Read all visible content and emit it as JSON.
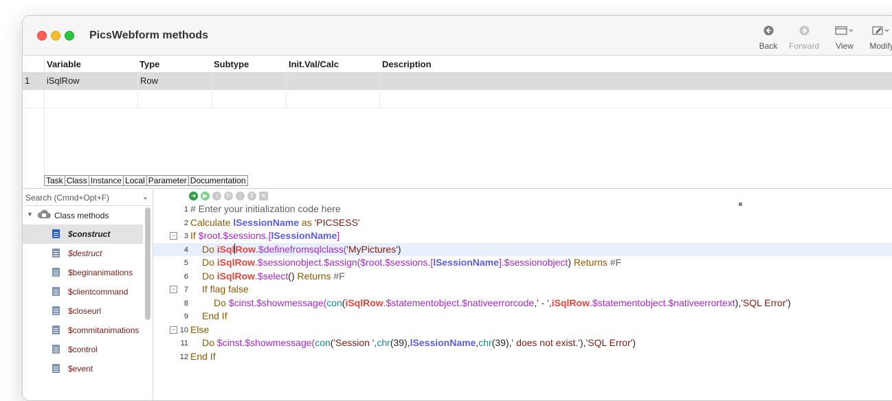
{
  "window": {
    "title": "PicsWebform methods"
  },
  "toolbar": {
    "back": "Back",
    "forward": "Forward",
    "view": "View",
    "modify": "Modify"
  },
  "variables": {
    "columns": [
      "Variable",
      "Type",
      "Subtype",
      "Init.Val/Calc",
      "Description"
    ],
    "rows": [
      {
        "num": "1",
        "variable": "iSqlRow",
        "type": "Row",
        "subtype": "",
        "init": "",
        "description": ""
      }
    ]
  },
  "tabs": [
    "Task",
    "Class",
    "Instance",
    "Local",
    "Parameter",
    "Documentation"
  ],
  "sidebar": {
    "search_placeholder": "Search (Cmnd+Opt+F)",
    "group_label": "Class methods",
    "methods": [
      "$construct",
      "$destruct",
      "$beginanimations",
      "$clientcommand",
      "$closeurl",
      "$commitanimations",
      "$control",
      "$event"
    ]
  },
  "code": {
    "line_numbers": [
      "1",
      "2",
      "3",
      "4",
      "5",
      "6",
      "7",
      "8",
      "9",
      "10",
      "11",
      "12"
    ]
  },
  "colors": {
    "comment": "#5f5f5f",
    "keyword": "#8b5a00",
    "notation": "#a62ac7",
    "class_var": "#5a5de0",
    "instance_var": "#e2453c",
    "string": "#7a1c12",
    "function": "#128c8c"
  }
}
